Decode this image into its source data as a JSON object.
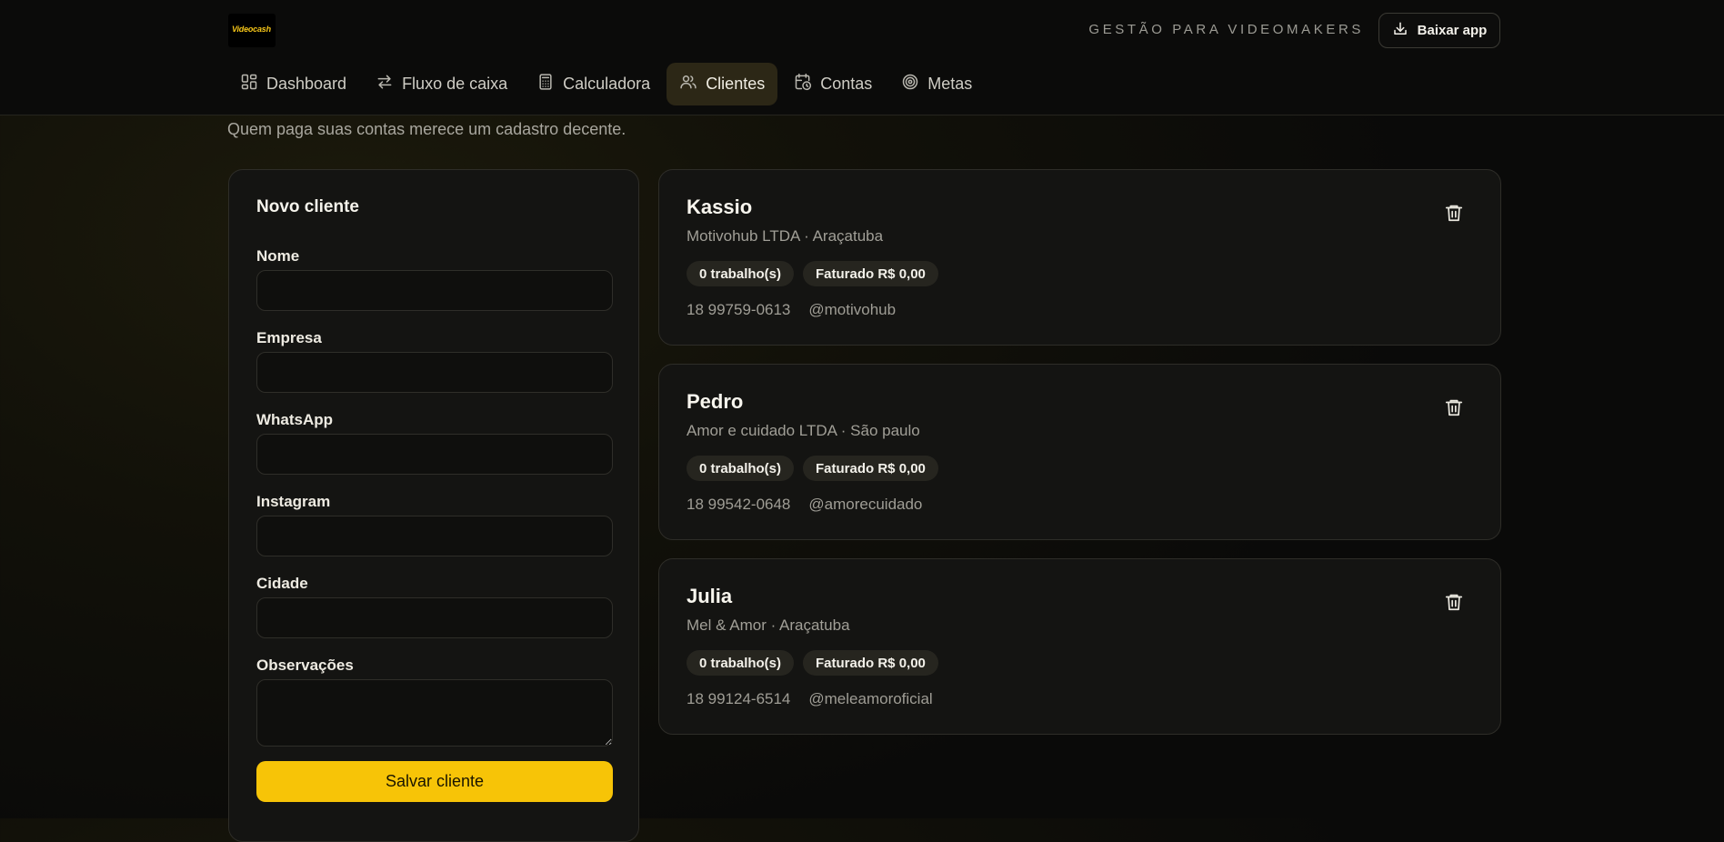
{
  "header": {
    "logo_text": "Videocash",
    "tagline": "GESTÃO PARA VIDEOMAKERS",
    "download_label": "Baixar app"
  },
  "nav": {
    "items": [
      {
        "label": "Dashboard",
        "icon": "grid-icon"
      },
      {
        "label": "Fluxo de caixa",
        "icon": "arrows-exchange-icon"
      },
      {
        "label": "Calculadora",
        "icon": "calculator-icon"
      },
      {
        "label": "Clientes",
        "icon": "users-icon",
        "active": true
      },
      {
        "label": "Contas",
        "icon": "calendar-clock-icon"
      },
      {
        "label": "Metas",
        "icon": "target-icon"
      }
    ]
  },
  "page": {
    "subtitle": "Quem paga suas contas merece um cadastro decente."
  },
  "form": {
    "title": "Novo cliente",
    "fields": {
      "nome": {
        "label": "Nome",
        "value": ""
      },
      "empresa": {
        "label": "Empresa",
        "value": ""
      },
      "whatsapp": {
        "label": "WhatsApp",
        "value": ""
      },
      "instagram": {
        "label": "Instagram",
        "value": ""
      },
      "cidade": {
        "label": "Cidade",
        "value": ""
      },
      "observacoes": {
        "label": "Observações",
        "value": ""
      }
    },
    "submit_label": "Salvar cliente"
  },
  "clients": [
    {
      "name": "Kassio",
      "details": "Motivohub LTDA · Araçatuba",
      "jobs": "0 trabalho(s)",
      "billed": "Faturado R$ 0,00",
      "phone": "18 99759-0613",
      "instagram": "@motivohub"
    },
    {
      "name": "Pedro",
      "details": "Amor e cuidado LTDA · São paulo",
      "jobs": "0 trabalho(s)",
      "billed": "Faturado R$ 0,00",
      "phone": "18 99542-0648",
      "instagram": "@amorecuidado"
    },
    {
      "name": "Julia",
      "details": "Mel & Amor · Araçatuba",
      "jobs": "0 trabalho(s)",
      "billed": "Faturado R$ 0,00",
      "phone": "18 99124-6514",
      "instagram": "@meleamoroficial"
    }
  ],
  "colors": {
    "accent": "#f7c407",
    "active_nav_bg": "#2c2716",
    "card_bg": "#141412",
    "page_bg": "#0a0a09"
  }
}
